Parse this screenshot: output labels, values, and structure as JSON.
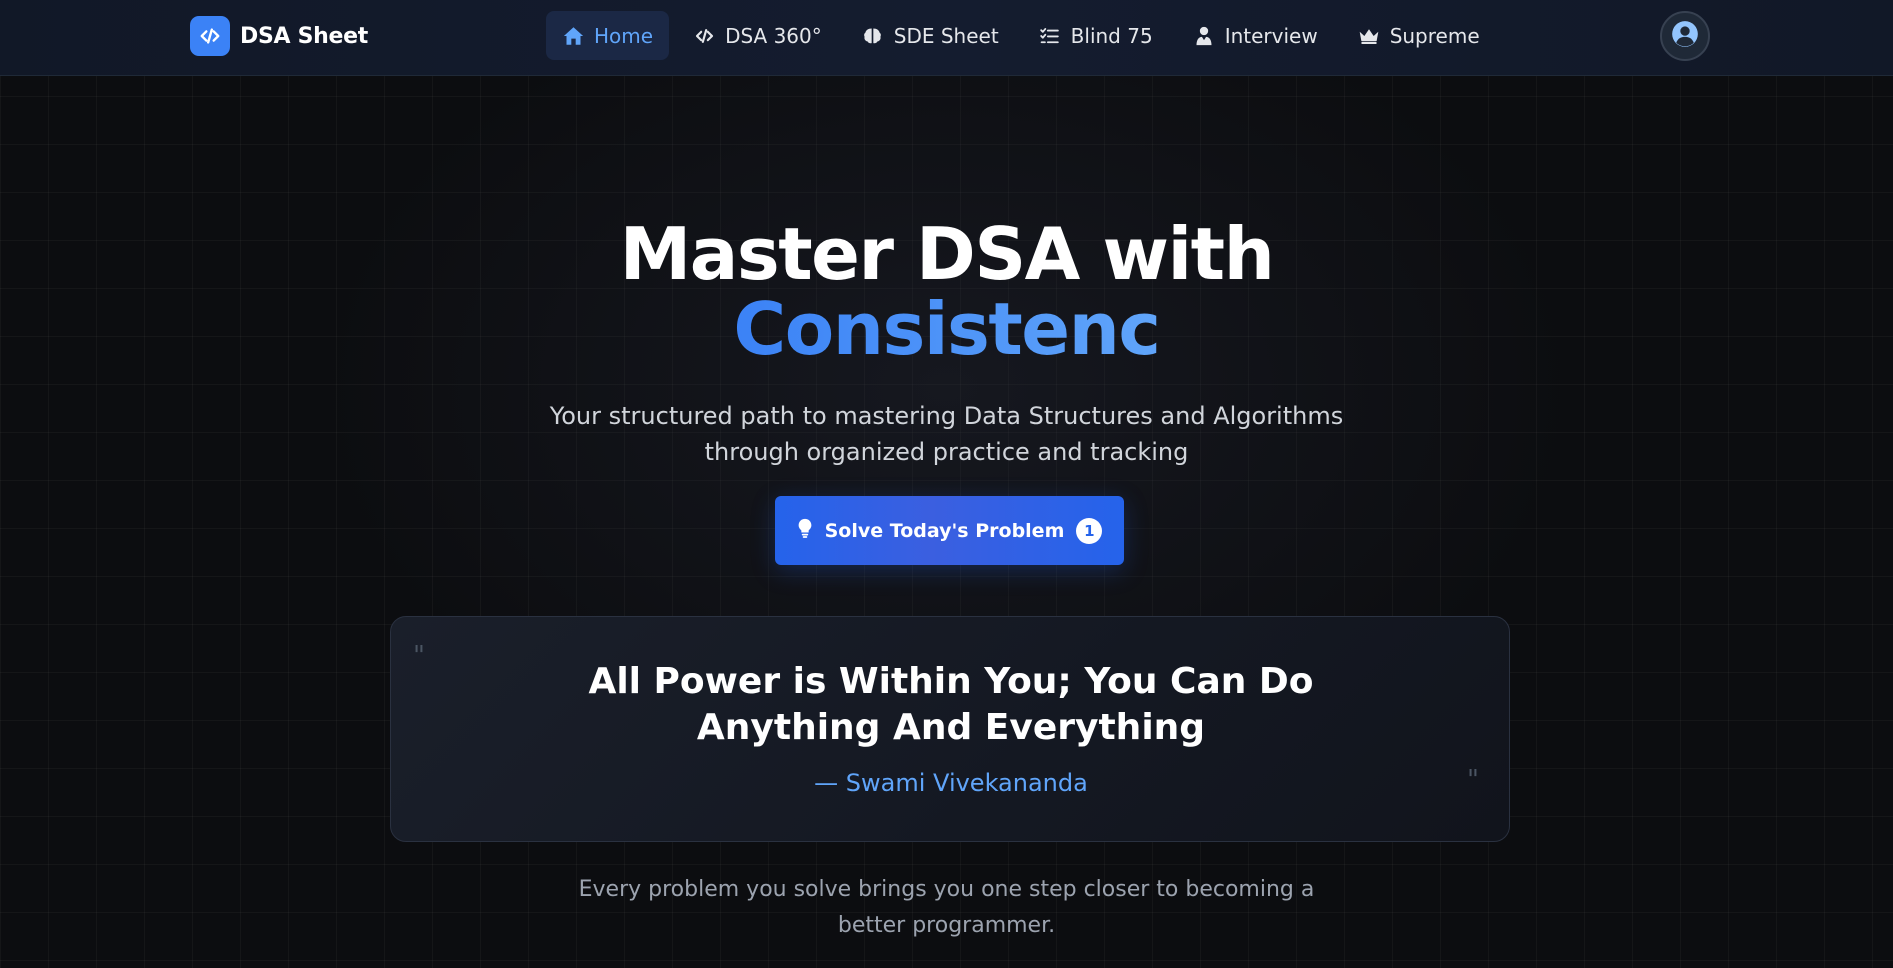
{
  "brand": {
    "name": "DSA Sheet",
    "logo_icon": "code-icon",
    "accent": "#3b82f6"
  },
  "nav": {
    "items": [
      {
        "label": "Home",
        "icon": "home-icon",
        "active": true
      },
      {
        "label": "DSA 360°",
        "icon": "code-icon",
        "active": false
      },
      {
        "label": "SDE Sheet",
        "icon": "brain-icon",
        "active": false
      },
      {
        "label": "Blind 75",
        "icon": "list-check-icon",
        "active": false
      },
      {
        "label": "Interview",
        "icon": "user-tie-icon",
        "active": false
      },
      {
        "label": "Supreme",
        "icon": "crown-icon",
        "active": false
      }
    ],
    "profile_icon": "user-circle-icon"
  },
  "hero": {
    "title": "Master DSA with",
    "accent": "Consistenc",
    "subtitle": "Your structured path to mastering Data Structures and Algorithms through organized practice and tracking",
    "cta": {
      "label": "Solve Today's Problem",
      "badge": "1",
      "icon": "lightbulb-icon"
    }
  },
  "quote": {
    "text": "All Power is Within You; You Can Do Anything And Everything",
    "author": "— Swami Vivekananda",
    "open_mark": "\"",
    "close_mark": "\""
  },
  "footer": {
    "text": "Every problem you solve brings you one step closer to becoming a better programmer."
  },
  "colors": {
    "background": "#0c0d10",
    "navbar": "#111827",
    "active_nav_bg": "#1b2845",
    "link_blue": "#60a5fa",
    "button_blue": "#2563eb"
  }
}
